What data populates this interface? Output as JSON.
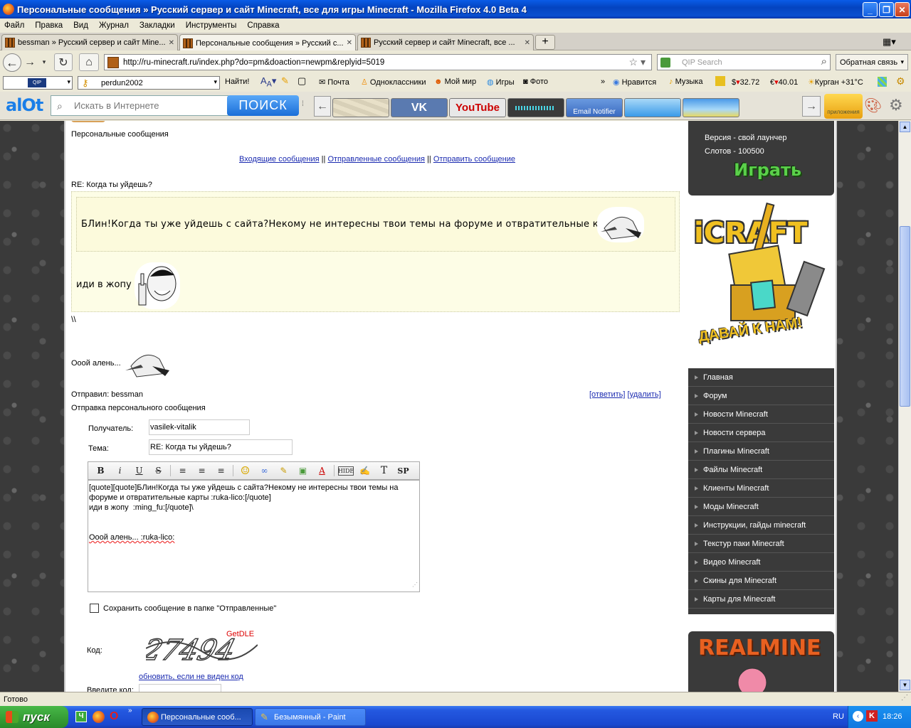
{
  "window": {
    "title": "Персональные сообщения » Русский сервер и сайт Minecraft, все для игры Minecraft - Mozilla Firefox 4.0 Beta 4"
  },
  "menu": [
    "Файл",
    "Правка",
    "Вид",
    "Журнал",
    "Закладки",
    "Инструменты",
    "Справка"
  ],
  "tabs": [
    {
      "label": "bessman » Русский сервер и сайт Mine..."
    },
    {
      "label": "Персональные сообщения » Русский с..."
    },
    {
      "label": "Русский сервер и сайт Minecraft, все ..."
    }
  ],
  "nav": {
    "url": "http://ru-minecraft.ru/index.php?do=pm&doaction=newpm&replyid=5019",
    "search_placeholder": "QIP Search",
    "feedback": "Обратная связь"
  },
  "bookmarks": {
    "user": "perdun2002",
    "find": "Найти!",
    "mail": "Почта",
    "ok": "Одноклассники",
    "mymir": "Мой мир",
    "games": "Игры",
    "photo": "Фото",
    "like": "Нравится",
    "music": "Музыка",
    "usd": "32.72",
    "eur": "40.01",
    "weather": "Курган +31°C"
  },
  "alot": {
    "logo": "alOt",
    "placeholder": "Искать в Интернете",
    "button": "ПОИСК",
    "email_notifier": "Email Notifier",
    "apps": "приложения"
  },
  "pm": {
    "section_title": "Персональные сообщения",
    "links": {
      "inbox": "Входящие сообщения",
      "sep": "||",
      "sent": "Отправленные сообщения",
      "send": "Отправить сообщение"
    },
    "subject": "RE: Когда ты уйдешь?",
    "quote_text": "БЛин!Когда ты уже уйдешь с сайта?Некому не интересны твои темы на форуме и отвратительные карты",
    "reply_text": "иди в жопу",
    "slashes": "\\\\",
    "oooy": "Ооой алень...",
    "sender_label": "Отправил: bessman",
    "reply_link": "[ответить]",
    "delete_link": "[удалить]"
  },
  "form": {
    "title": "Отправка персонального сообщения",
    "recipient_label": "Получатель:",
    "recipient_value": "vasilek-vitalik",
    "subject_label": "Тема:",
    "subject_value": "RE: Когда ты уйдешь?",
    "toolbar": [
      "B",
      "i",
      "U",
      "S",
      "≡",
      "≡",
      "≡",
      "☺",
      "∞",
      "✎",
      "▣",
      "A",
      "HIDE",
      "✍",
      "T",
      "SP"
    ],
    "body_line1": "[quote][quote]БЛин!Когда ты уже уйдешь с сайта?Некому не интересны твои темы на",
    "body_line2": "форуме и отвратительные карты :ruka-lico:[/quote]",
    "body_line3": "иди в жопу  :ming_fu:[/quote]\\",
    "body_line4": "Ооой алень... :ruka-lico:",
    "save_label": "Сохранить сообщение в папке \"Отправленные\"",
    "code_label": "Код:",
    "captcha_watermark": "GetDLE",
    "refresh_link": "обновить, если не виден код",
    "enter_code_label": "Введите код:"
  },
  "sidebar": {
    "version": "Версия -  свой лаунчер",
    "slots": "Слотов - 100500",
    "play": "Играть",
    "icraft_logo": "iCRAFT",
    "icraft_slogan": "ДАВАЙ К НАМ!",
    "menu": [
      "Главная",
      "Форум",
      "Новости Minecraft",
      "Новости сервера",
      "Плагины Minecraft",
      "Файлы Minecraft",
      "Клиенты Minecraft",
      "Моды Minecraft",
      "Инструкции, гайды minecraft",
      "Текстур паки Minecraft",
      "Видео Minecraft",
      "Скины для Minecraft",
      "Карты для Minecraft"
    ],
    "realmine": "REALMINE"
  },
  "status": "Готово",
  "taskbar": {
    "start": "пуск",
    "task1": "Персональные сооб...",
    "task2": "Безымянный - Paint",
    "lang": "RU",
    "time": "18:26"
  }
}
